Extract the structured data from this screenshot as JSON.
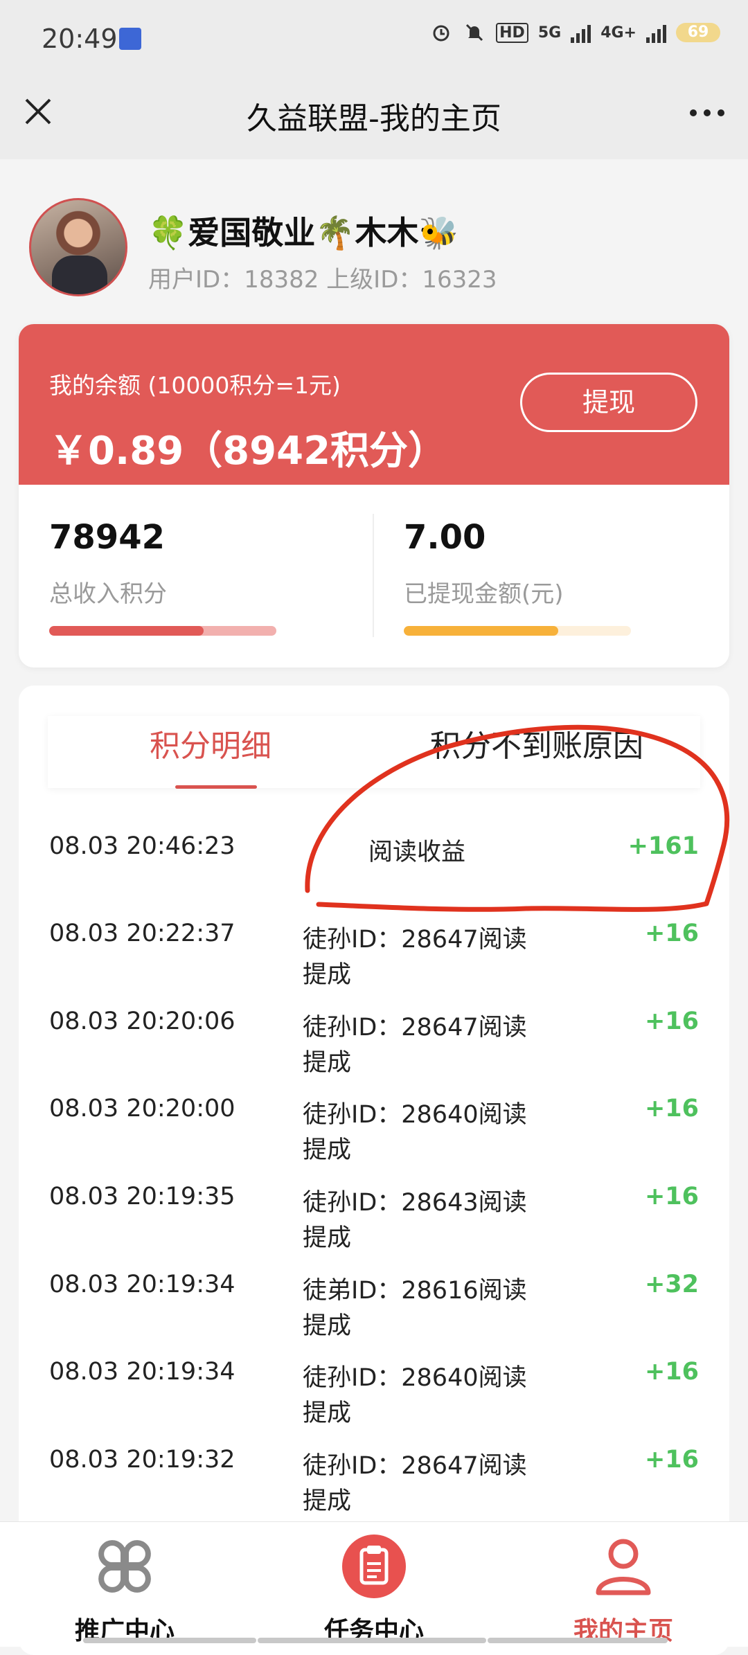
{
  "status_bar": {
    "time": "20:49",
    "network_left": "5G",
    "network_right": "4G+",
    "battery": "69",
    "hd_label": "HD"
  },
  "header": {
    "title": "久益联盟-我的主页",
    "close_icon": "close-icon",
    "more_icon": "more-icon"
  },
  "profile": {
    "name": "🍀爱国敬业🌴木木🐝",
    "ids": "用户ID：18382 上级ID：16323"
  },
  "balance": {
    "label": "我的余额 (10000积分=1元)",
    "value": "￥0.89（8942积分）",
    "withdraw_label": "提现"
  },
  "stats": {
    "total_income": {
      "value": "78942",
      "label": "总收入积分",
      "progress": 0.68,
      "color": "#e15a57",
      "track": "#f2b0ae"
    },
    "withdrawn": {
      "value": "7.00",
      "label": "已提现金额(元)",
      "progress": 0.68,
      "color": "#f7b13a",
      "track": "#fdf0dc"
    }
  },
  "tabs": [
    {
      "label": "积分明细",
      "active": true
    },
    {
      "label": "积分不到账原因",
      "active": false
    }
  ],
  "records": [
    {
      "time": "08.03 20:46:23",
      "desc": "阅读收益",
      "amount": "+161"
    },
    {
      "time": "08.03 20:22:37",
      "desc": "徒孙ID：28647阅读提成",
      "amount": "+16"
    },
    {
      "time": "08.03 20:20:06",
      "desc": "徒孙ID：28647阅读提成",
      "amount": "+16"
    },
    {
      "time": "08.03 20:20:00",
      "desc": "徒孙ID：28640阅读提成",
      "amount": "+16"
    },
    {
      "time": "08.03 20:19:35",
      "desc": "徒孙ID：28643阅读提成",
      "amount": "+16"
    },
    {
      "time": "08.03 20:19:34",
      "desc": "徒弟ID：28616阅读提成",
      "amount": "+32"
    },
    {
      "time": "08.03 20:19:34",
      "desc": "徒孙ID：28640阅读提成",
      "amount": "+16"
    },
    {
      "time": "08.03 20:19:32",
      "desc": "徒孙ID：28647阅读提成",
      "amount": "+16"
    }
  ],
  "bottom_nav": [
    {
      "label": "推广中心",
      "icon": "clover-icon",
      "active": false
    },
    {
      "label": "任务中心",
      "icon": "clipboard-icon",
      "active": false
    },
    {
      "label": "我的主页",
      "icon": "user-icon",
      "active": true
    }
  ],
  "colors": {
    "accent": "#e15a57",
    "positive": "#4ec15d",
    "annotation": "#e0321e"
  }
}
